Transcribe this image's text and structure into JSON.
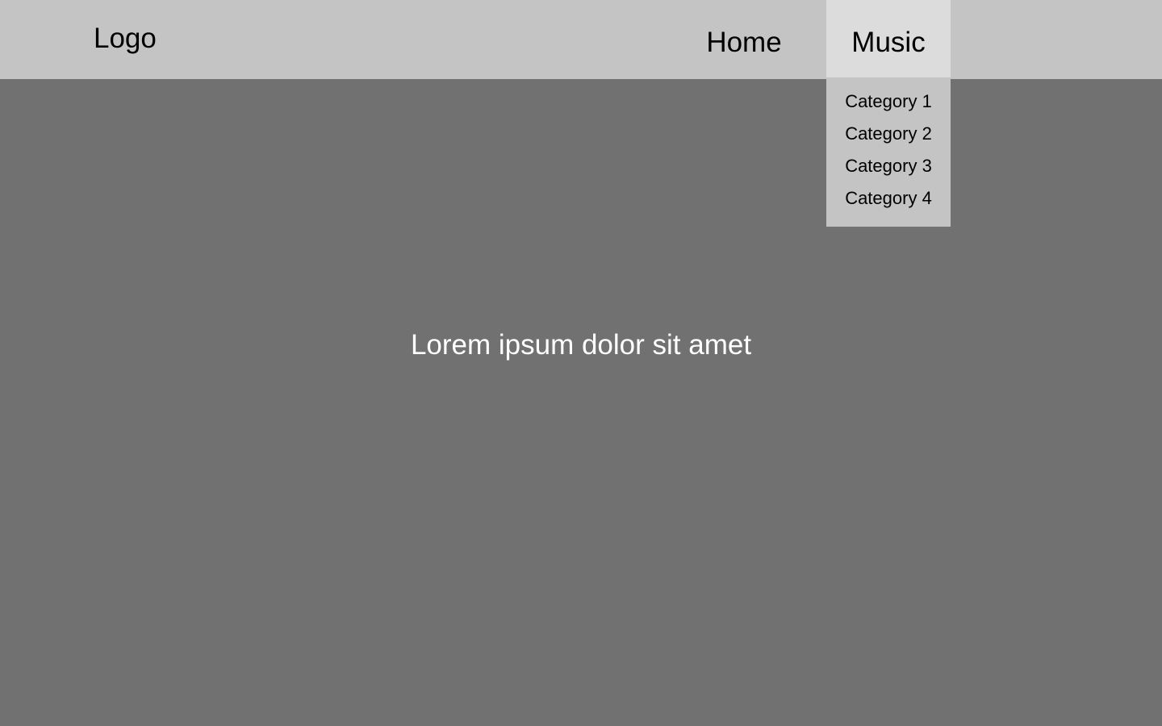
{
  "header": {
    "logo_text": "Logo",
    "nav": {
      "home_label": "Home",
      "music_label": "Music"
    }
  },
  "dropdown": {
    "items": [
      {
        "label": "Category 1"
      },
      {
        "label": "Category 2"
      },
      {
        "label": "Category 3"
      },
      {
        "label": "Category 4"
      }
    ]
  },
  "main": {
    "hero_text": "Lorem ipsum dolor sit amet"
  },
  "colors": {
    "page_background": "#717171",
    "header_background": "#c4c4c4",
    "active_nav_background": "#dcdcdc",
    "dropdown_background": "#c4c4c4",
    "hero_text_color": "#ffffff"
  }
}
